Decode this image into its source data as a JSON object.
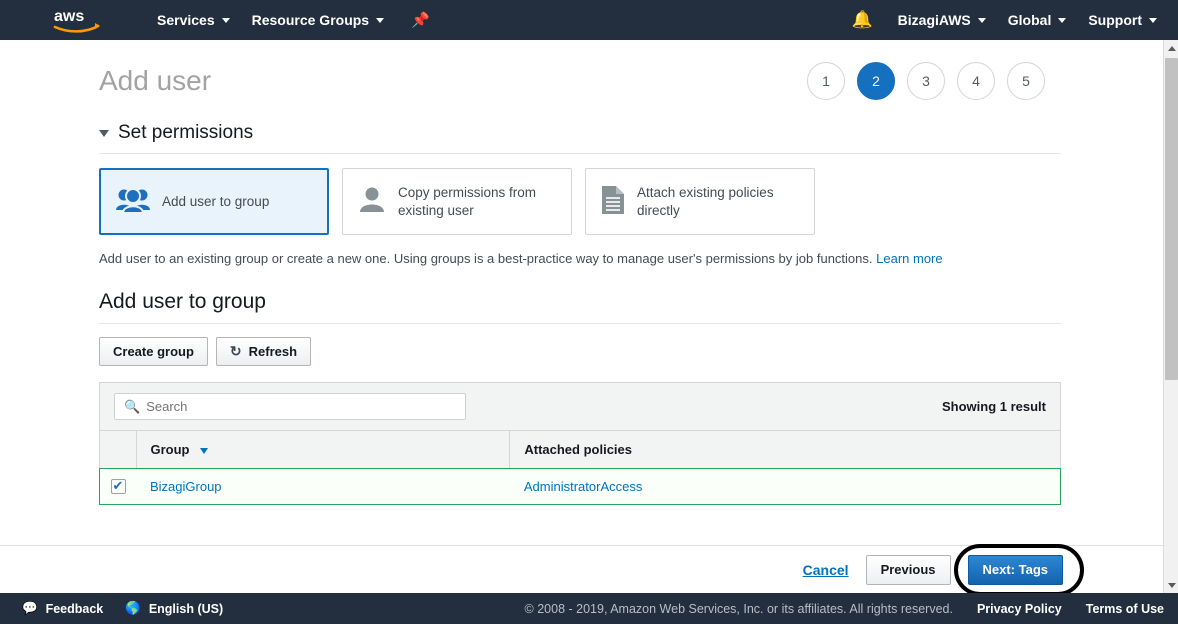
{
  "topnav": {
    "logo_alt": "aws",
    "items": [
      {
        "label": "Services",
        "icon": "chevron-down-icon"
      },
      {
        "label": "Resource Groups",
        "icon": "chevron-down-icon"
      }
    ],
    "pin_icon": "pin-icon",
    "bell_icon": "bell-icon",
    "right_items": [
      {
        "label": "BizagiAWS",
        "icon": "chevron-down-icon"
      },
      {
        "label": "Global",
        "icon": "chevron-down-icon"
      },
      {
        "label": "Support",
        "icon": "chevron-down-icon"
      }
    ]
  },
  "page": {
    "title": "Add user",
    "steps": [
      {
        "label": "1",
        "active": false
      },
      {
        "label": "2",
        "active": true
      },
      {
        "label": "3",
        "active": false
      },
      {
        "label": "4",
        "active": false
      },
      {
        "label": "5",
        "active": false
      }
    ]
  },
  "permissions": {
    "section_title": "Set permissions",
    "cards": [
      {
        "label": "Add user to group",
        "icon": "group-users-icon",
        "selected": true
      },
      {
        "label": "Copy permissions from existing user",
        "icon": "user-icon",
        "selected": false
      },
      {
        "label": "Attach existing policies directly",
        "icon": "document-icon",
        "selected": false
      }
    ],
    "helper_text": "Add user to an existing group or create a new one. Using groups is a best-practice way to manage user's permissions by job functions.",
    "learn_more": "Learn more"
  },
  "group_section": {
    "heading": "Add user to group",
    "create_group_label": "Create group",
    "refresh_label": "Refresh",
    "search_placeholder": "Search",
    "search_value": "",
    "result_count": "Showing 1 result",
    "columns": [
      "Group",
      "Attached policies"
    ],
    "rows": [
      {
        "checked": true,
        "group": "BizagiGroup",
        "policies": "AdministratorAccess"
      }
    ]
  },
  "actions": {
    "cancel_label": "Cancel",
    "previous_label": "Previous",
    "next_label": "Next: Tags"
  },
  "bottombar": {
    "feedback_label": "Feedback",
    "language_label": "English (US)",
    "copyright": "© 2008 - 2019, Amazon Web Services, Inc. or its affiliates. All rights reserved.",
    "privacy_label": "Privacy Policy",
    "terms_label": "Terms of Use"
  },
  "colors": {
    "nav_bg": "#232f3e",
    "accent_blue": "#1570bf",
    "link_blue": "#0073bb",
    "selected_card_bg": "#e8f3fc",
    "row_green": "#26a65b",
    "aws_orange": "#ff9900"
  }
}
